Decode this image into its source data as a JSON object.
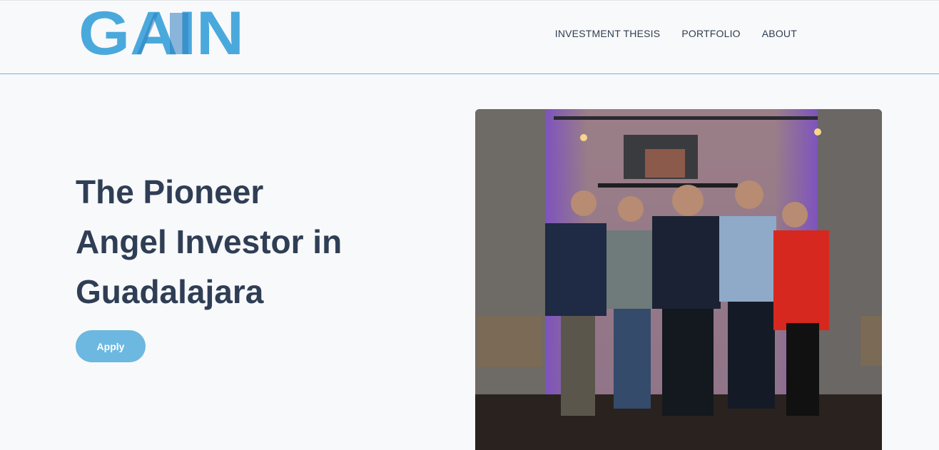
{
  "header": {
    "logo_text": "GAIN",
    "nav": [
      "INVESTMENT THESIS",
      "PORTFOLIO",
      "ABOUT"
    ]
  },
  "hero": {
    "title_lines": [
      "The Pioneer",
      "Angel Investor in",
      "Guadalajara"
    ],
    "apply_label": "Apply"
  },
  "colors": {
    "brand_light_blue": "#4aa9dc",
    "brand_dark_blue": "#2e7dbf",
    "text_dark": "#2f3e55",
    "button_blue": "#6cb8e0"
  }
}
